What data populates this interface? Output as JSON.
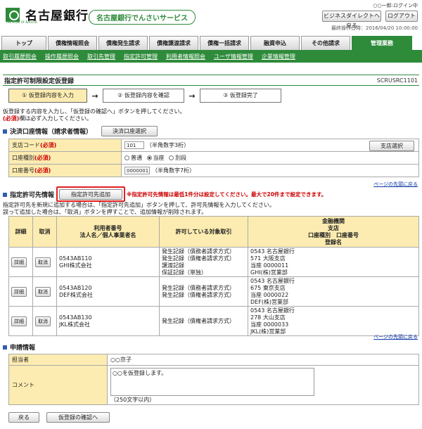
{
  "header": {
    "bank_name": "名古屋銀行",
    "bank_sub": "THE BANK OF NAGOYA",
    "service": "名古屋銀行でんさいサービス",
    "user": "○○一郎:ログイン中",
    "btn_business": "ビジネスダイレクトへ戻る",
    "btn_logout": "ログアウト",
    "last_op": "最終操作日時：2016/04/20 10:00:00"
  },
  "tabs": [
    "トップ",
    "債権情報照会",
    "債権発生請求",
    "債権譲渡請求",
    "債権一括請求",
    "融資申込",
    "その他請求",
    "管理業務"
  ],
  "subnav": [
    "取引履歴照会",
    "操作履歴照会",
    "取引先管理",
    "指定許可管理",
    "利用者情報照会",
    "ユーザ情報管理",
    "企業情報管理"
  ],
  "page": {
    "title": "指定許可制限設定仮登録",
    "code": "SCRUSRC1101"
  },
  "steps": [
    "① 仮登録内容を入力",
    "② 仮登録内容を確認",
    "③ 仮登録完了"
  ],
  "intro": {
    "line1": "仮登録する内容を入力し、「仮登録の確認へ」ボタンを押してください。",
    "req_mark": "(必須)",
    "line2": "欄は必ず入力してください。"
  },
  "settle": {
    "title": "決済口座情報（請求者情報）",
    "select_btn": "決済口座選択",
    "branch_label": "支店コード",
    "req": "(必須)",
    "branch_value": "101",
    "branch_hint": "（半角数字3桁）",
    "branch_btn": "支店選択",
    "type_label": "口座種別",
    "type_opts": [
      "普通",
      "当座",
      "別段"
    ],
    "acct_label": "口座番号",
    "acct_value": "0000001",
    "acct_hint": "（半角数字7桁）"
  },
  "to_top": "ページの先頭に戻る",
  "permit": {
    "title": "指定許可先情報",
    "add_btn": "指定許可先追加",
    "warn": "※指定許可先情報は最低1件分は設定してください。最大で20件まで設定できます。",
    "note1": "指定許可先を新規に追加する場合は、「指定許可先追加」ボタンを押して、許可先情報を入力してください。",
    "note2": "誤って追加した場合は、「取消」ボタンを押すことで、追加情報が削除されます。",
    "headers": {
      "detail": "詳細",
      "cancel": "取消",
      "user": "利用者番号\n法人名／個人事業者名",
      "target": "許可している対象取引",
      "bank": "金融機関\n支店\n口座種別　口座番号\n登録名"
    },
    "rows": [
      {
        "user_no": "0543AB110",
        "name": "GHI株式会社",
        "target": "発生記録（債務者請求方式）\n発生記録（債権者請求方式）\n譲渡記録\n保証記録（単独）",
        "bank": "0543 名古屋銀行\n571 大阪支店\n当座 0000011\nGHI(株)営業部"
      },
      {
        "user_no": "0543AB120",
        "name": "DEF株式会社",
        "target": "発生記録（債務者請求方式）\n発生記録（債権者請求方式）",
        "bank": "0543 名古屋銀行\n675 東京支店\n当座 0000022\nDEF(株)営業部"
      },
      {
        "user_no": "0543AB130",
        "name": "JKL株式会社",
        "target": "発生記録（債権者請求方式）",
        "bank": "0543 名古屋銀行\n278 大山支店\n当座 0000033\nJKL(株)営業部"
      }
    ],
    "btn_detail": "詳細",
    "btn_cancel": "取消"
  },
  "apply": {
    "title": "申請情報",
    "staff_label": "担当者",
    "staff_value": "○○京子",
    "comment_label": "コメント",
    "comment_value": "○○を仮登録します。",
    "comment_hint": "（250文字以内）"
  },
  "footer": {
    "back": "戻る",
    "confirm": "仮登録の確認へ"
  },
  "colors": {
    "green": "#2e8b3a",
    "label_bg": "#fcecb1",
    "highlight": "#e02020"
  }
}
